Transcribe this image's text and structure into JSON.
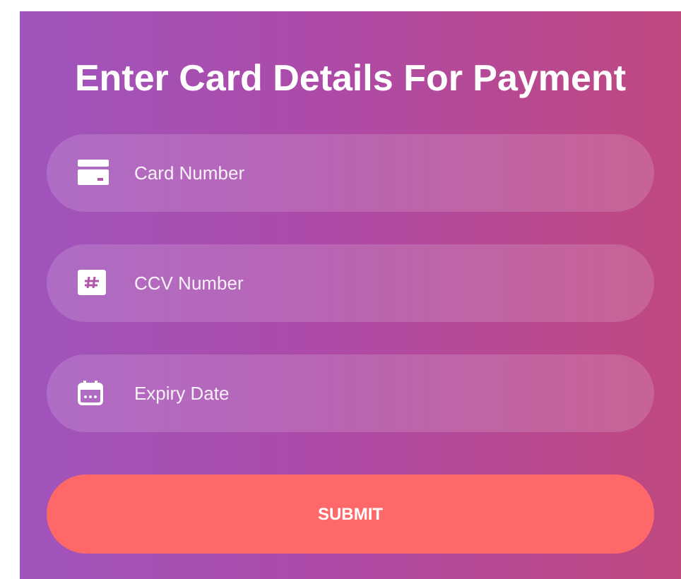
{
  "title": "Enter Card Details For Payment",
  "fields": [
    {
      "kind": "card",
      "placeholder": "Card Number"
    },
    {
      "kind": "hash",
      "placeholder": "CCV Number"
    },
    {
      "kind": "calendar",
      "placeholder": "Expiry Date"
    }
  ],
  "submit": "SUBMIT"
}
